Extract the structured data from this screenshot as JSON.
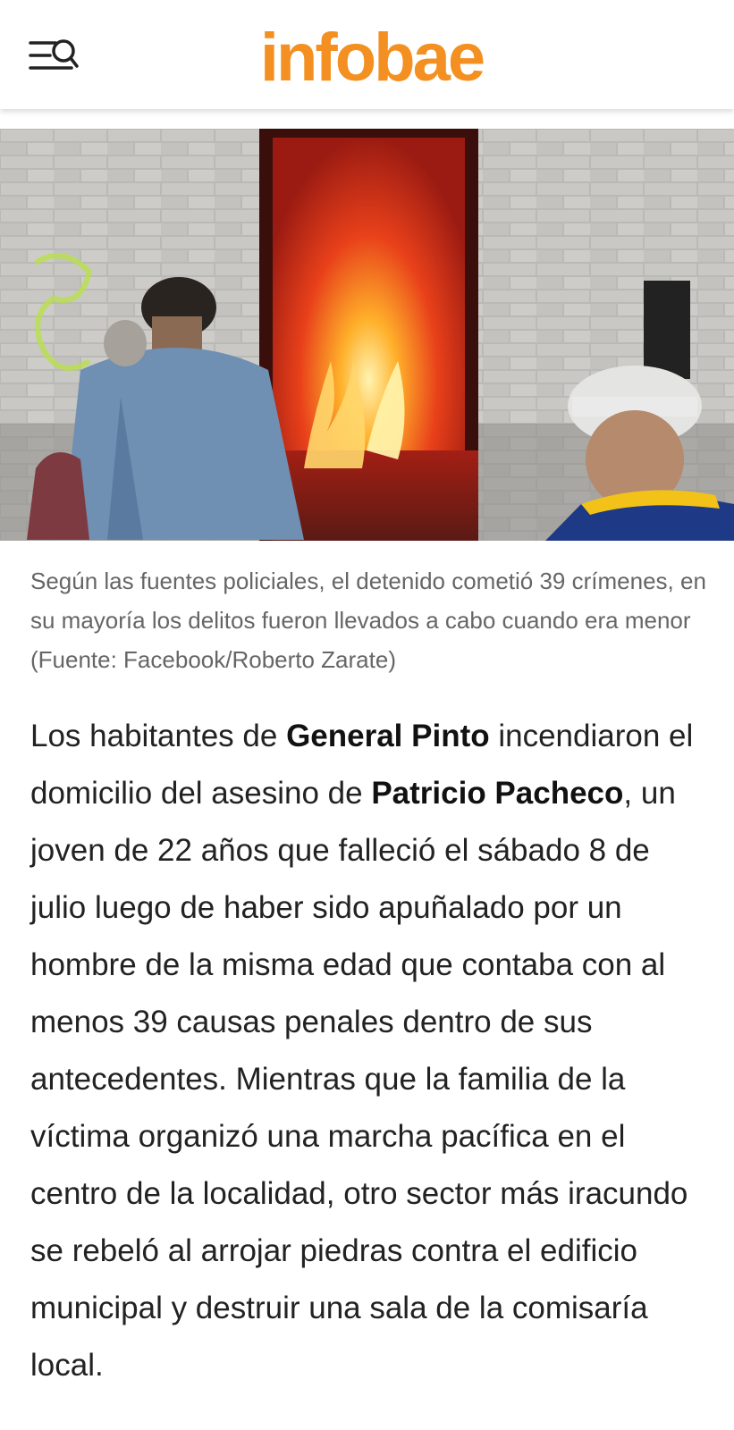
{
  "header": {
    "logo_text": "infobae",
    "menu_icon": "menu-search-icon",
    "brand_color": "#f39021"
  },
  "article": {
    "hero_image_alt": "Según las fuentes policiales, el detenido cometió 39 crímenes",
    "caption": "Según las fuentes policiales, el detenido cometió 39 crímenes, en su mayoría los delitos fueron llevados a cabo cuando era menor (Fuente: Facebook/Roberto Zarate)",
    "paragraph": {
      "p1": "Los habitantes de ",
      "b1": "General Pinto",
      "p2": " incendiaron el domicilio del asesino de ",
      "b2": "Patricio Pacheco",
      "p3": ", un joven de 22 años que falleció el sábado 8 de julio luego de haber sido apuñalado por un hombre de la misma edad que contaba con al menos 39 causas penales dentro de sus antecedentes. Mientras que la familia de la víctima organizó una marcha pacífica en el centro de la localidad, otro sector más iracundo se rebeló al arrojar piedras contra el edificio municipal y destruir una sala de la comisaría local."
    }
  }
}
